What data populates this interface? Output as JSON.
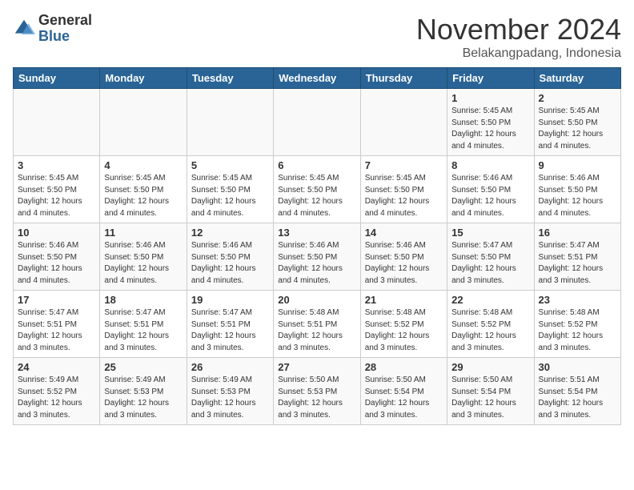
{
  "header": {
    "logo_general": "General",
    "logo_blue": "Blue",
    "month_title": "November 2024",
    "subtitle": "Belakangpadang, Indonesia"
  },
  "columns": [
    "Sunday",
    "Monday",
    "Tuesday",
    "Wednesday",
    "Thursday",
    "Friday",
    "Saturday"
  ],
  "weeks": [
    {
      "days": [
        {
          "num": "",
          "detail": ""
        },
        {
          "num": "",
          "detail": ""
        },
        {
          "num": "",
          "detail": ""
        },
        {
          "num": "",
          "detail": ""
        },
        {
          "num": "",
          "detail": ""
        },
        {
          "num": "1",
          "detail": "Sunrise: 5:45 AM\nSunset: 5:50 PM\nDaylight: 12 hours\nand 4 minutes."
        },
        {
          "num": "2",
          "detail": "Sunrise: 5:45 AM\nSunset: 5:50 PM\nDaylight: 12 hours\nand 4 minutes."
        }
      ]
    },
    {
      "days": [
        {
          "num": "3",
          "detail": "Sunrise: 5:45 AM\nSunset: 5:50 PM\nDaylight: 12 hours\nand 4 minutes."
        },
        {
          "num": "4",
          "detail": "Sunrise: 5:45 AM\nSunset: 5:50 PM\nDaylight: 12 hours\nand 4 minutes."
        },
        {
          "num": "5",
          "detail": "Sunrise: 5:45 AM\nSunset: 5:50 PM\nDaylight: 12 hours\nand 4 minutes."
        },
        {
          "num": "6",
          "detail": "Sunrise: 5:45 AM\nSunset: 5:50 PM\nDaylight: 12 hours\nand 4 minutes."
        },
        {
          "num": "7",
          "detail": "Sunrise: 5:45 AM\nSunset: 5:50 PM\nDaylight: 12 hours\nand 4 minutes."
        },
        {
          "num": "8",
          "detail": "Sunrise: 5:46 AM\nSunset: 5:50 PM\nDaylight: 12 hours\nand 4 minutes."
        },
        {
          "num": "9",
          "detail": "Sunrise: 5:46 AM\nSunset: 5:50 PM\nDaylight: 12 hours\nand 4 minutes."
        }
      ]
    },
    {
      "days": [
        {
          "num": "10",
          "detail": "Sunrise: 5:46 AM\nSunset: 5:50 PM\nDaylight: 12 hours\nand 4 minutes."
        },
        {
          "num": "11",
          "detail": "Sunrise: 5:46 AM\nSunset: 5:50 PM\nDaylight: 12 hours\nand 4 minutes."
        },
        {
          "num": "12",
          "detail": "Sunrise: 5:46 AM\nSunset: 5:50 PM\nDaylight: 12 hours\nand 4 minutes."
        },
        {
          "num": "13",
          "detail": "Sunrise: 5:46 AM\nSunset: 5:50 PM\nDaylight: 12 hours\nand 4 minutes."
        },
        {
          "num": "14",
          "detail": "Sunrise: 5:46 AM\nSunset: 5:50 PM\nDaylight: 12 hours\nand 3 minutes."
        },
        {
          "num": "15",
          "detail": "Sunrise: 5:47 AM\nSunset: 5:50 PM\nDaylight: 12 hours\nand 3 minutes."
        },
        {
          "num": "16",
          "detail": "Sunrise: 5:47 AM\nSunset: 5:51 PM\nDaylight: 12 hours\nand 3 minutes."
        }
      ]
    },
    {
      "days": [
        {
          "num": "17",
          "detail": "Sunrise: 5:47 AM\nSunset: 5:51 PM\nDaylight: 12 hours\nand 3 minutes."
        },
        {
          "num": "18",
          "detail": "Sunrise: 5:47 AM\nSunset: 5:51 PM\nDaylight: 12 hours\nand 3 minutes."
        },
        {
          "num": "19",
          "detail": "Sunrise: 5:47 AM\nSunset: 5:51 PM\nDaylight: 12 hours\nand 3 minutes."
        },
        {
          "num": "20",
          "detail": "Sunrise: 5:48 AM\nSunset: 5:51 PM\nDaylight: 12 hours\nand 3 minutes."
        },
        {
          "num": "21",
          "detail": "Sunrise: 5:48 AM\nSunset: 5:52 PM\nDaylight: 12 hours\nand 3 minutes."
        },
        {
          "num": "22",
          "detail": "Sunrise: 5:48 AM\nSunset: 5:52 PM\nDaylight: 12 hours\nand 3 minutes."
        },
        {
          "num": "23",
          "detail": "Sunrise: 5:48 AM\nSunset: 5:52 PM\nDaylight: 12 hours\nand 3 minutes."
        }
      ]
    },
    {
      "days": [
        {
          "num": "24",
          "detail": "Sunrise: 5:49 AM\nSunset: 5:52 PM\nDaylight: 12 hours\nand 3 minutes."
        },
        {
          "num": "25",
          "detail": "Sunrise: 5:49 AM\nSunset: 5:53 PM\nDaylight: 12 hours\nand 3 minutes."
        },
        {
          "num": "26",
          "detail": "Sunrise: 5:49 AM\nSunset: 5:53 PM\nDaylight: 12 hours\nand 3 minutes."
        },
        {
          "num": "27",
          "detail": "Sunrise: 5:50 AM\nSunset: 5:53 PM\nDaylight: 12 hours\nand 3 minutes."
        },
        {
          "num": "28",
          "detail": "Sunrise: 5:50 AM\nSunset: 5:54 PM\nDaylight: 12 hours\nand 3 minutes."
        },
        {
          "num": "29",
          "detail": "Sunrise: 5:50 AM\nSunset: 5:54 PM\nDaylight: 12 hours\nand 3 minutes."
        },
        {
          "num": "30",
          "detail": "Sunrise: 5:51 AM\nSunset: 5:54 PM\nDaylight: 12 hours\nand 3 minutes."
        }
      ]
    }
  ]
}
